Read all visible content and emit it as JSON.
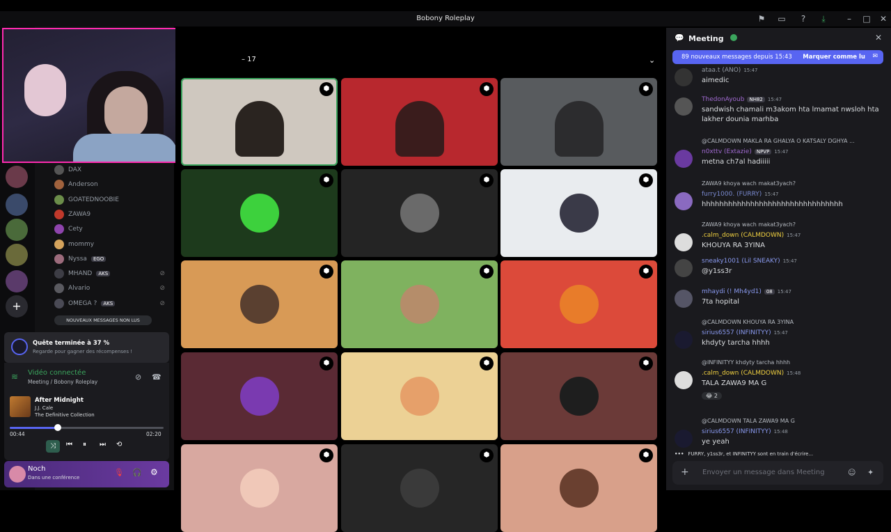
{
  "window": {
    "title": "Bobony Roleplay"
  },
  "channel_header": {
    "count": "– 17"
  },
  "members": [
    {
      "name": "DAX",
      "color": "#949ba4",
      "avatar": "#555"
    },
    {
      "name": "Anderson",
      "color": "#949ba4",
      "avatar": "#a0623d"
    },
    {
      "name": "GOATEDNOOBIE",
      "color": "#949ba4",
      "avatar": "#6b8d4a"
    },
    {
      "name": "ZAWA9",
      "color": "#949ba4",
      "avatar": "#c0392b"
    },
    {
      "name": "Cety",
      "color": "#949ba4",
      "avatar": "#8e44ad"
    },
    {
      "name": "mommy",
      "color": "#949ba4",
      "avatar": "#d4a35c"
    },
    {
      "name": "Nyssa",
      "tag": "EGO",
      "color": "#949ba4",
      "avatar": "#9c6b7c"
    },
    {
      "name": "MHAND",
      "tag": "AKS",
      "color": "#949ba4",
      "avatar": "#3d3d45"
    },
    {
      "name": "Alvario",
      "color": "#949ba4",
      "avatar": "#5a5a60"
    },
    {
      "name": "OMEGA ?",
      "tag": "AKS",
      "color": "#949ba4",
      "avatar": "#4a4a55"
    }
  ],
  "unread_pill": "NOUVEAUX MESSAGES NON LUS",
  "quest": {
    "title": "Quête terminée à 37 %",
    "subtitle": "Regarde pour gagner des récompenses !",
    "progress": 37
  },
  "voice": {
    "status": "Vidéo connectée",
    "channel": "Meeting",
    "server": "/ Bobony Roleplay"
  },
  "music": {
    "track": "After Midnight",
    "artist": "J.J. Cale",
    "album": "The Definitive Collection",
    "elapsed": "00:44",
    "total": "02:20",
    "progress": 0.31
  },
  "user": {
    "name": "Noch",
    "status": "Dans une conférence"
  },
  "tiles": [
    {
      "bg": "#cfc8bf",
      "pic": "#2a2420",
      "cam": true,
      "speaking": true
    },
    {
      "bg": "#b8282e",
      "pic": "#3a1c1c",
      "cam": true
    },
    {
      "bg": "#585b5e",
      "pic": "#2c2c2e",
      "cam": true
    },
    {
      "bg": "#1d3a1c",
      "pic": "#3dd13d"
    },
    {
      "bg": "#242424",
      "pic": "#6a6a6a"
    },
    {
      "bg": "#e9ecef",
      "pic": "#3a3a48"
    },
    {
      "bg": "#d89a56",
      "pic": "#5a4030"
    },
    {
      "bg": "#7fb25f",
      "pic": "#b58d6a"
    },
    {
      "bg": "#dc4a3a",
      "pic": "#e87c2a"
    },
    {
      "bg": "#5a2a34",
      "pic": "#7a3ab0"
    },
    {
      "bg": "#ecd195",
      "pic": "#e6a06a"
    },
    {
      "bg": "#6b3a38",
      "pic": "#1e1e1e"
    },
    {
      "bg": "#d8a8a0",
      "pic": "#f0c8b8"
    },
    {
      "bg": "#262626",
      "pic": "#3a3a3a"
    },
    {
      "bg": "#d8a08a",
      "pic": "#6a4030"
    }
  ],
  "chat": {
    "title": "Meeting",
    "new_messages": "89 nouveaux messages depuis 15:43",
    "mark_read": "Marquer comme lu",
    "messages": [
      {
        "name": "ataa.t (ANO)",
        "color": "#949ba4",
        "time": "15:47",
        "text": "aimedic",
        "avatar": "#333"
      },
      {
        "name": "ThedonAyoub",
        "badge": "NH82",
        "color": "#a06ad0",
        "time": "15:47",
        "text": "sandwish chamali m3akom hta lmamat nwsloh hta lakher dounia marhba",
        "avatar": "#555"
      },
      {
        "reply": "@CALMDOWN MAKLA RA GHALYA O KATSALY DGHYA ...",
        "name": "n0xttv (Extazie)",
        "badge": "NPVP",
        "color": "#a06ad0",
        "time": "15:47",
        "text": "metna ch7al hadiiiii",
        "avatar": "#6a3aa0"
      },
      {
        "reply": "ZAWA9 khoya wach makat3yach?",
        "name": "furry1000. (FURRY)",
        "color": "#7a8ad0",
        "time": "15:47",
        "text": "hhhhhhhhhhhhhhhhhhhhhhhhhhhhhhhh",
        "avatar": "#8a6ac0"
      },
      {
        "reply": "ZAWA9 khoya wach makat3yach?",
        "name": ".calm_down (CALMDOWN)",
        "color": "#f0d040",
        "time": "15:47",
        "text": "KHOUYA RA 3YINA",
        "avatar": "#ddd"
      },
      {
        "name": "sneaky1001 (Lil SNEAKY)",
        "color": "#8a9af0",
        "time": "15:47",
        "text": "@y1ss3r",
        "avatar": "#444"
      },
      {
        "name": "mhaydi (! Mh4yd1)",
        "badge": "08",
        "color": "#8a9af0",
        "time": "15:47",
        "text": "7ta hopital",
        "avatar": "#556"
      },
      {
        "reply": "@CALMDOWN KHOUYA RA 3YINA",
        "name": "sirius6557 (INFINITYY)",
        "color": "#8a9af0",
        "time": "15:47",
        "text": "khdyty tarcha hhhh",
        "avatar": "#1a1a30"
      },
      {
        "reply": "@INFINITYY khdyty tarcha hhhh",
        "name": ".calm_down (CALMDOWN)",
        "color": "#f0d040",
        "time": "15:48",
        "text": "TALA ZAWA9 MA G",
        "avatar": "#ddd",
        "reaction": "2"
      },
      {
        "reply": "@CALMDOWN TALA ZAWA9 MA G",
        "name": "sirius6557 (INFINITYY)",
        "color": "#8a9af0",
        "time": "15:48",
        "text": "ye yeah",
        "avatar": "#1a1a30"
      }
    ],
    "typing": "FURRY, y1ss3r, et INFINITYY sont en train d'écrire...",
    "input_placeholder": "Envoyer un message dans Meeting"
  }
}
